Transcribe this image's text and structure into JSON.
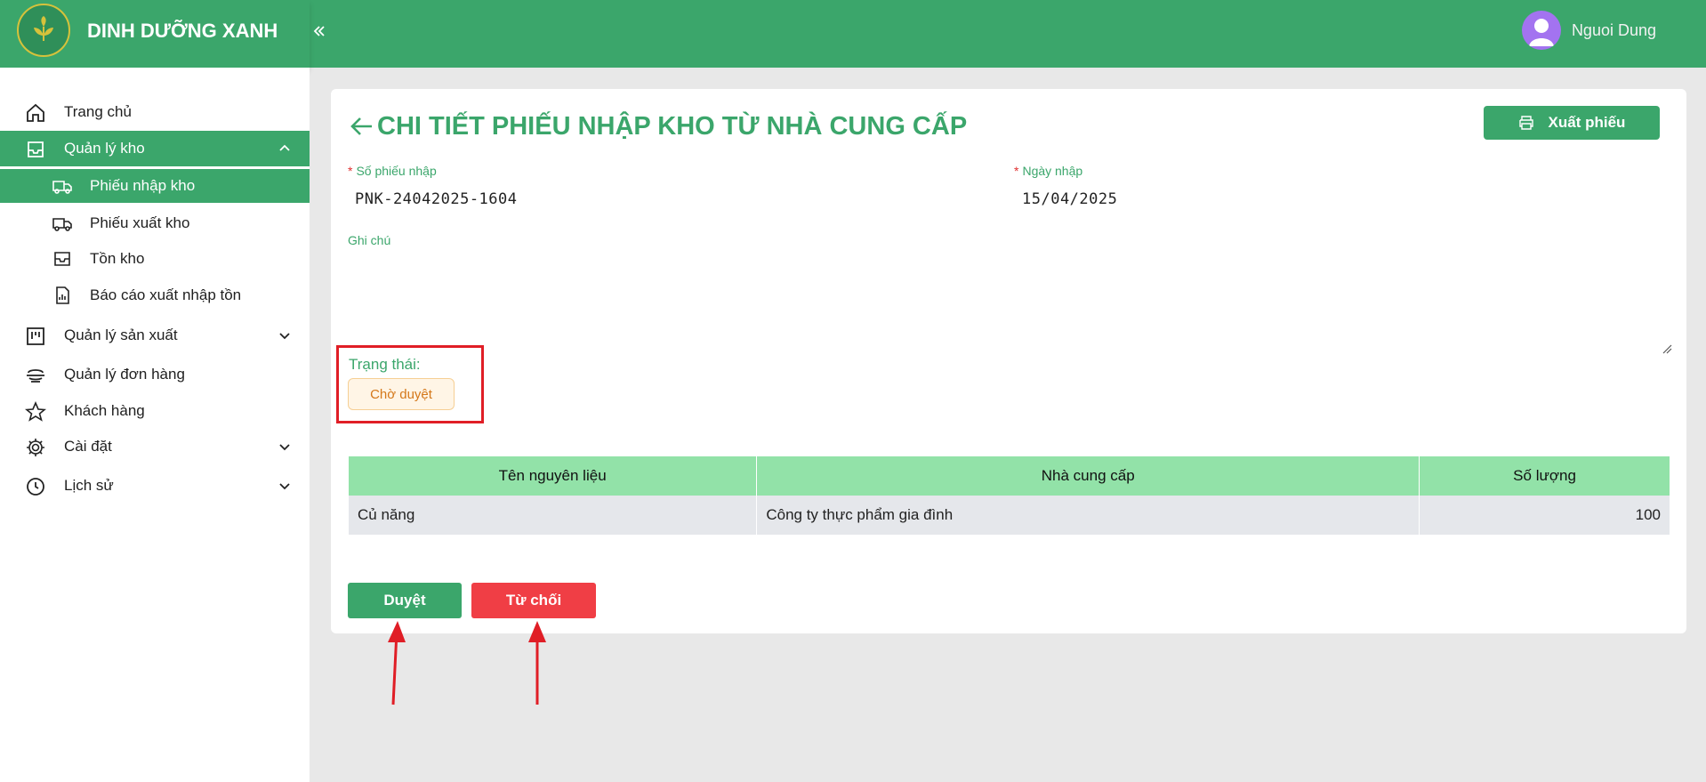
{
  "app": {
    "brand_name": "DINH DƯỠNG XANH",
    "brand_color": "#3ba66b",
    "user_name": "Nguoi Dung"
  },
  "sidebar": {
    "items": [
      {
        "label": "Trang chủ",
        "icon": "home-icon"
      },
      {
        "label": "Quản lý kho",
        "icon": "inbox-icon",
        "expanded": true
      },
      {
        "label": "Quản lý sản xuất",
        "icon": "kanban-icon"
      },
      {
        "label": "Quản lý đơn hàng",
        "icon": "orders-icon"
      },
      {
        "label": "Khách hàng",
        "icon": "star-icon"
      },
      {
        "label": "Cài đặt",
        "icon": "gear-icon"
      },
      {
        "label": "Lịch sử",
        "icon": "clock-icon"
      }
    ],
    "subitems": [
      {
        "label": "Phiếu nhập kho",
        "icon": "truck-in-icon"
      },
      {
        "label": "Phiếu xuất kho",
        "icon": "truck-out-icon"
      },
      {
        "label": "Tồn kho",
        "icon": "inbox-icon"
      },
      {
        "label": "Báo cáo xuất nhập tồn",
        "icon": "report-icon"
      }
    ]
  },
  "page": {
    "title": "CHI TIẾT PHIẾU NHẬP KHO TỪ NHÀ CUNG CẤP",
    "export_label": "Xuất phiếu",
    "receipt_no_label": "Số phiếu nhập",
    "receipt_no_value": "PNK-24042025-1604",
    "date_label": "Ngày nhập",
    "date_value": "15/04/2025",
    "note_label": "Ghi chú",
    "status_label": "Trạng thái:",
    "status_value": "Chờ duyệt"
  },
  "table": {
    "headers": [
      "Tên nguyên liệu",
      "Nhà cung cấp",
      "Số lượng"
    ],
    "rows": [
      [
        "Củ năng",
        "Công ty thực phẩm gia đình",
        "100"
      ]
    ]
  },
  "actions": {
    "approve_label": "Duyệt",
    "reject_label": "Từ chối",
    "approve_color": "#3ba66b",
    "reject_color": "#f03e45"
  }
}
